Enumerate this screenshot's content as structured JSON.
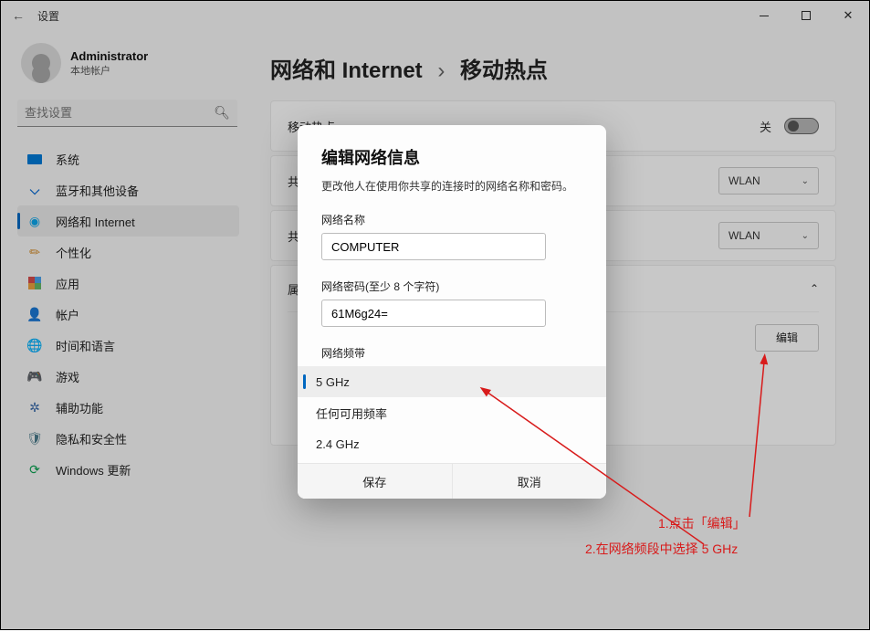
{
  "window": {
    "title": "设置",
    "back_icon": "←",
    "min_tip": "最小化",
    "max_tip": "最大化",
    "close_tip": "关闭"
  },
  "user": {
    "name": "Administrator",
    "subtitle": "本地帐户"
  },
  "search": {
    "placeholder": "查找设置"
  },
  "nav": {
    "system": "系统",
    "bluetooth": "蓝牙和其他设备",
    "network": "网络和 Internet",
    "personalization": "个性化",
    "apps": "应用",
    "accounts": "帐户",
    "time": "时间和语言",
    "gaming": "游戏",
    "accessibility": "辅助功能",
    "privacy": "隐私和安全性",
    "update": "Windows 更新"
  },
  "breadcrumb": {
    "parent": "网络和 Internet",
    "sep": "›",
    "current": "移动热点"
  },
  "rows": {
    "hotspot_label": "移动热点",
    "off_text": "关",
    "share_from_prefix": "共",
    "share_over_prefix": "共",
    "wlan": "WLAN",
    "props_prefix": "属",
    "edit_btn": "编辑"
  },
  "dialog": {
    "title": "编辑网络信息",
    "desc": "更改他人在使用你共享的连接时的网络名称和密码。",
    "name_label": "网络名称",
    "name_value": "COMPUTER",
    "pwd_label": "网络密码(至少 8 个字符)",
    "pwd_value": "61M6g24=",
    "band_label": "网络频带",
    "bands": {
      "b5": "5 GHz",
      "any": "任何可用频率",
      "b24": "2.4 GHz"
    },
    "save": "保存",
    "cancel": "取消"
  },
  "annotations": {
    "line1": "1.点击「编辑」",
    "line2": "2.在网络频段中选择 5 GHz"
  }
}
